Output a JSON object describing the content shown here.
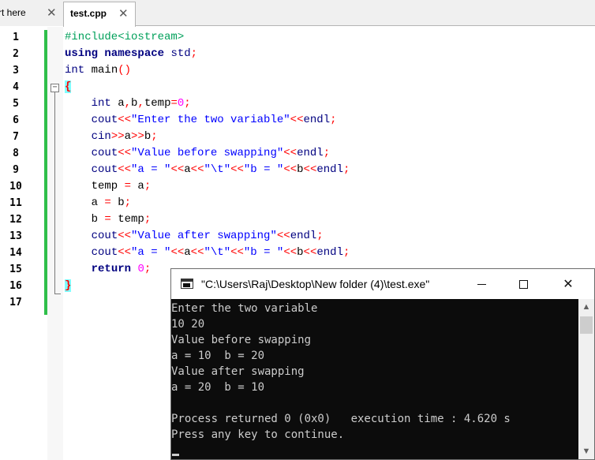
{
  "tabs": [
    {
      "label": "rt here",
      "close_glyph": "✕"
    },
    {
      "label": "test.cpp",
      "close_glyph": "✕"
    }
  ],
  "editor": {
    "line_numbers": [
      "1",
      "2",
      "3",
      "4",
      "5",
      "6",
      "7",
      "8",
      "9",
      "10",
      "11",
      "12",
      "13",
      "14",
      "15",
      "16",
      "17"
    ],
    "fold_glyph": "−"
  },
  "console": {
    "title": "\"C:\\Users\\Raj\\Desktop\\New folder (4)\\test.exe\"",
    "close_glyph": "✕",
    "lines": [
      "Enter the two variable",
      "10 20",
      "Value before swapping",
      "a = 10  b = 20",
      "Value after swapping",
      "a = 20  b = 10",
      "",
      "Process returned 0 (0x0)   execution time : 4.620 s",
      "Press any key to continue."
    ],
    "scroll_up_glyph": "▲",
    "scroll_down_glyph": "▼"
  },
  "colors": {
    "preprocessor": "#00a05a",
    "keyword": "#000080",
    "string": "#0000ff",
    "number": "#ff00ff",
    "operator": "#ff0000",
    "change_bar": "#2fbf4a",
    "brace_highlight": "#80ffff"
  }
}
